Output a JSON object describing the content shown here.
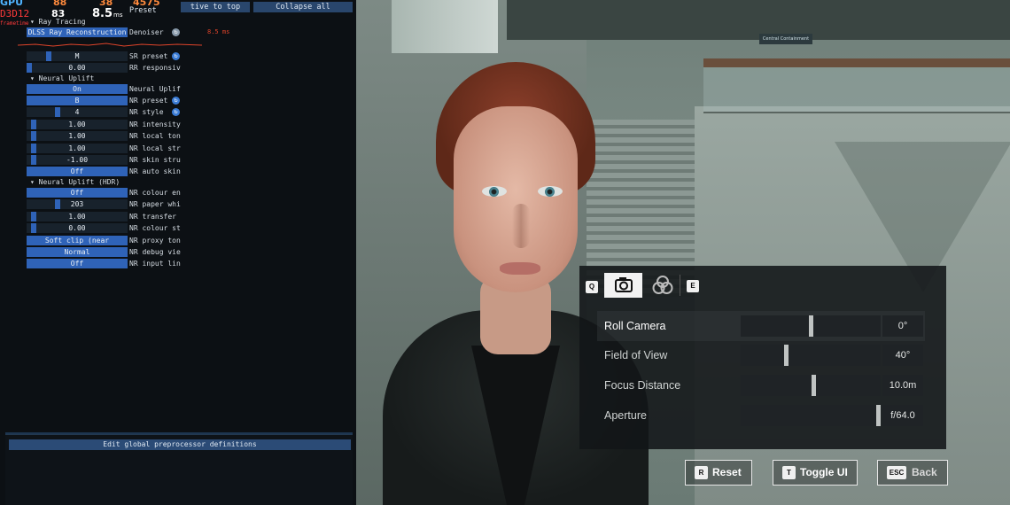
{
  "debug": {
    "hud": {
      "gpu": "GPU",
      "api": "D3D12",
      "api_value": "83",
      "fps_a": "88",
      "fps_b": "38",
      "fps_c": "4575",
      "ms_value": "8.5",
      "ms_unit": "ms",
      "frametime": "frametime",
      "preset_label": "Preset",
      "ms_right": "8.5 ms"
    },
    "buttons": {
      "relative_to_top": "tive to top",
      "collapse_all": "Collapse all",
      "edit_global": "Edit global preprocessor definitions"
    },
    "sections": {
      "ray_tracing": "Ray Tracing",
      "neural_uplift": "Neural Uplift",
      "neural_uplift_hdr": "Neural Uplift (HDR)"
    },
    "rows": [
      {
        "value": "DLSS Ray Reconstruction",
        "label": "Denoiser",
        "fill": 1.0
      },
      {
        "value": "M",
        "label": "SR preset",
        "fill": 0.2
      },
      {
        "value": "0.00",
        "label": "RR responsiv",
        "fill": 0.0
      },
      {
        "value": "On",
        "label": "Neural Uplif",
        "fill": 1.0
      },
      {
        "value": "B",
        "label": "NR preset",
        "fill": 1.0
      },
      {
        "value": "4",
        "label": "NR style",
        "fill": 0.3
      },
      {
        "value": "1.00",
        "label": "NR intensity",
        "fill": 0.05
      },
      {
        "value": "1.00",
        "label": "NR local ton",
        "fill": 0.05
      },
      {
        "value": "1.00",
        "label": "NR local str",
        "fill": 0.05
      },
      {
        "value": "-1.00",
        "label": "NR skin stru",
        "fill": 0.05
      },
      {
        "value": "Off",
        "label": "NR auto skin",
        "fill": 1.0
      },
      {
        "value": "Off",
        "label": "NR colour en",
        "fill": 1.0
      },
      {
        "value": "203",
        "label": "NR paper whi",
        "fill": 0.3
      },
      {
        "value": "1.00",
        "label": "NR transfer",
        "fill": 0.05
      },
      {
        "value": "0.00",
        "label": "NR colour st",
        "fill": 0.05
      },
      {
        "value": "Soft clip (near identity)",
        "label": "NR proxy ton",
        "fill": 1.0
      },
      {
        "value": "Normal",
        "label": "NR debug vie",
        "fill": 1.0
      },
      {
        "value": "Off",
        "label": "NR input lin",
        "fill": 1.0
      }
    ]
  },
  "scene": {
    "sign_text": "Central Containment"
  },
  "photo_mode": {
    "tab_keys": {
      "left": "Q",
      "right": "E"
    },
    "active_tab": "camera",
    "sliders": [
      {
        "name": "Roll Camera",
        "value": "0°",
        "position": 0.5
      },
      {
        "name": "Field of View",
        "value": "40°",
        "position": 0.32
      },
      {
        "name": "Focus Distance",
        "value": "10.0m",
        "position": 0.52
      },
      {
        "name": "Aperture",
        "value": "f/64.0",
        "position": 1.0
      }
    ],
    "buttons": {
      "reset": {
        "key": "R",
        "label": "Reset"
      },
      "toggle_ui": {
        "key": "T",
        "label": "Toggle UI"
      },
      "back": {
        "key": "ESC",
        "label": "Back"
      }
    }
  }
}
